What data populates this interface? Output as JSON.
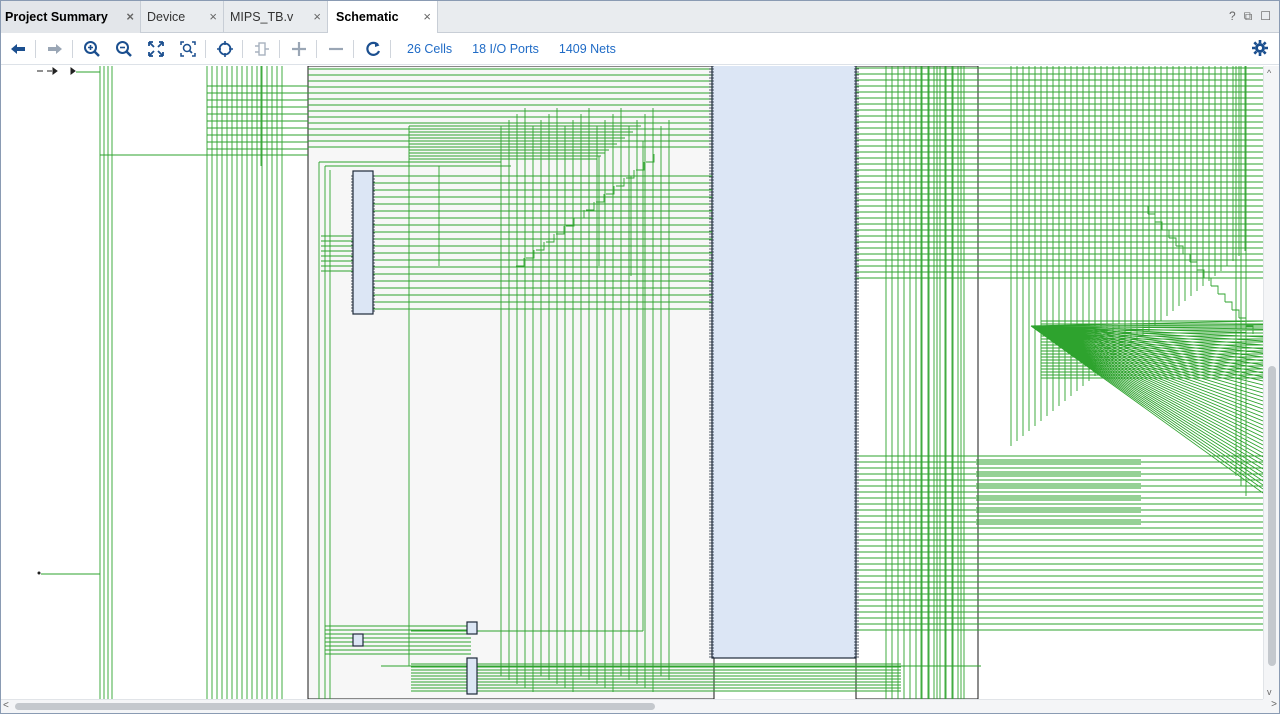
{
  "tabs": [
    {
      "label": "Project Summary",
      "close": "×"
    },
    {
      "label": "Device",
      "close": "×"
    },
    {
      "label": "MIPS_TB.v",
      "close": "×"
    },
    {
      "label": "Schematic",
      "close": "×"
    }
  ],
  "window_controls": {
    "help": "?",
    "restore": "⧉",
    "maximize": "☐"
  },
  "toolbar": {
    "buttons": [
      "back-arrow",
      "forward-arrow",
      "zoom-in",
      "zoom-out",
      "fit-view",
      "zoom-area",
      "select-target",
      "collapse-cell",
      "expand",
      "collapse",
      "refresh"
    ],
    "stats": {
      "cells": "26 Cells",
      "ports": "18 I/O Ports",
      "nets": "1409 Nets"
    }
  },
  "colors": {
    "wire": "#2ea32e",
    "cell_fill": "#dce6f5",
    "cell_border": "#1e2a3a",
    "accent": "#1f6bc6"
  }
}
